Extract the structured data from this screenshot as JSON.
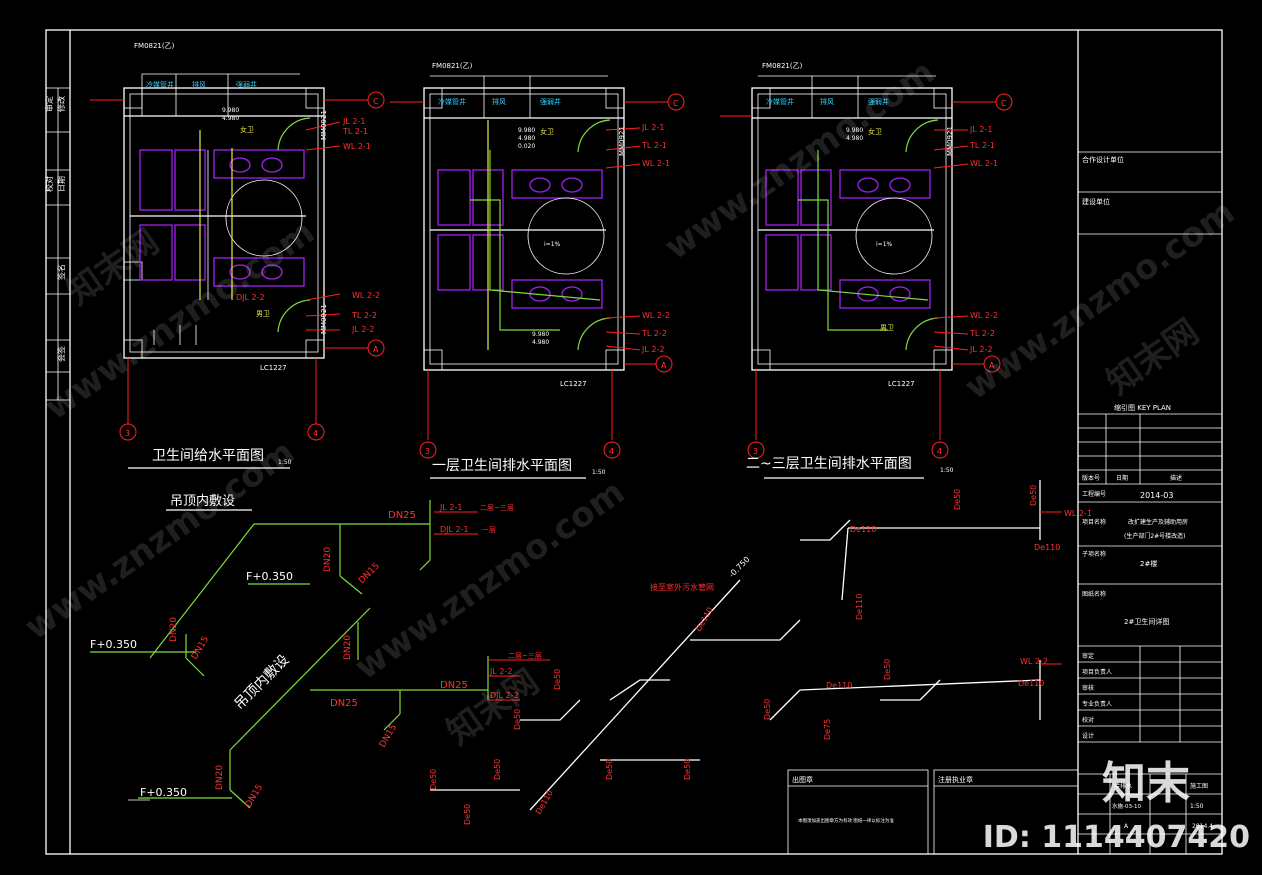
{
  "drawing": {
    "titles": {
      "plan1": "卫生间给水平面图",
      "plan1_scale": "1:50",
      "plan2": "一层卫生间排水平面图",
      "plan2_scale": "1:50",
      "plan3": "二~三层卫生间排水平面图",
      "plan3_scale": "1:50"
    },
    "plan_labels": {
      "door_top": "FM0821(乙)",
      "door_side": "MM0921",
      "window": "LC1227",
      "axis_c": "C",
      "axis_a": "A",
      "axis_3": "3",
      "axis_4": "4",
      "room_a": "冷媒管井",
      "room_b": "排风",
      "room_c": "强弱井",
      "female": "女卫",
      "male": "男卫",
      "elev1": "9.980",
      "elev2": "4.980",
      "elev3": "0.020",
      "slope": "i=1%"
    },
    "riser_tags": {
      "jl21": "JL 2-1",
      "jl22": "JL 2-2",
      "wl21": "WL 2-1",
      "wl22": "WL 2-2",
      "tl21": "TL 2-1",
      "tl22": "TL 2-2",
      "djl21": "DJL 2-1",
      "djl22": "DJL 2-2",
      "floor23": "二层~三层",
      "floor1": "一层"
    },
    "iso_labels": {
      "ceiling1": "吊顶内敷设",
      "ceiling2": "吊顶内敷设",
      "dn25": "DN25",
      "dn20": "DN20",
      "dn15": "DN15",
      "f0350": "F+0.350",
      "de50": "De50",
      "de110": "De110",
      "de75": "De75",
      "outdoor": "接至室外污水管网",
      "el0750": "-0.750"
    }
  },
  "title_block": {
    "left_strip": [
      "修改",
      "日期",
      "签名",
      "会签",
      "审定",
      "校对"
    ],
    "partner": "合作设计单位",
    "client": "建设单位",
    "key_plan": "缩引图 KEY PLAN",
    "rev_col1": "版本号",
    "rev_col2": "日期",
    "rev_col3": "描述",
    "project_no_label": "工程编号",
    "project_no": "2014-03",
    "project_name_label": "项目名称",
    "project_name_1": "改扩建生产及辅助用房",
    "project_name_2": "(生产部门2#号楼改造)",
    "sub_label": "子项名称",
    "sub_name": "2#楼",
    "sheet_label": "图纸名称",
    "sheet_name": "2#卫生间详图",
    "approve": "审定",
    "proj_lead": "项目负责人",
    "review": "审核",
    "discipline_lead": "专业负责人",
    "check": "校对",
    "design": "设计",
    "discipline": "给排水",
    "stage": "施工图",
    "sheet_no": "水施-03-10",
    "scale": "1:50",
    "date": "2014.4",
    "version": "A"
  },
  "bottom_notes": {
    "note_head": "出图章",
    "note_text": "本图须加盖出图章方为有效 图纸一律以标注为准",
    "reg_head": "注册执业章"
  },
  "watermarks": {
    "site": "www.znzmo.com",
    "brand": "知末网",
    "logo": "知末",
    "id": "ID: 1114407420"
  }
}
